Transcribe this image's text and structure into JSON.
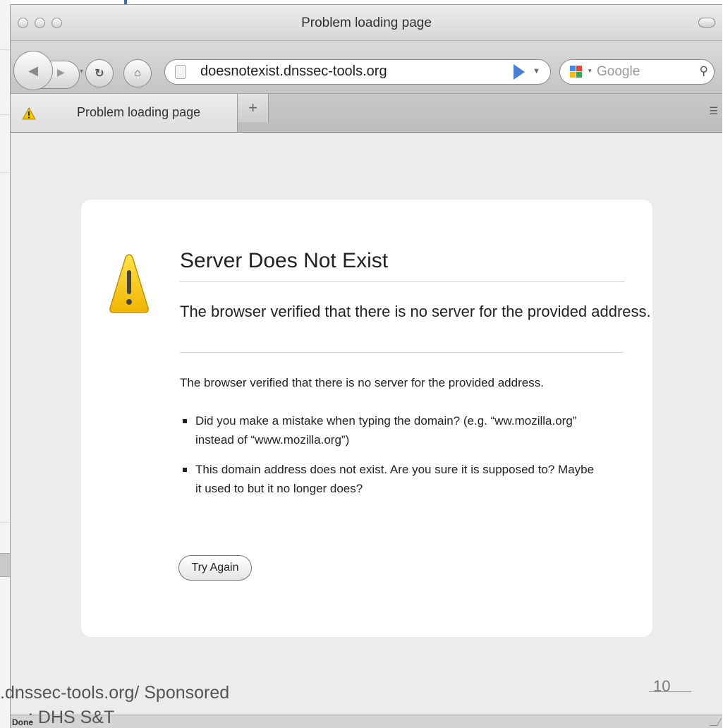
{
  "window": {
    "title": "Problem loading page"
  },
  "toolbar": {
    "url": "doesnotexist.dnssec-tools.org",
    "search_placeholder": "Google",
    "go_color": "#4a7fd6"
  },
  "tabs": [
    {
      "label": "Problem loading page",
      "icon": "warning-icon"
    }
  ],
  "new_tab_label": "+",
  "error": {
    "title": "Server Does Not Exist",
    "short_desc": "The browser verified that there is no server for the provided address.",
    "long_desc": "The browser verified that there is no server for the provided address.",
    "bullets": [
      "Did you make a mistake when typing the domain? (e.g. “ww.mozilla.org” instead of “www.mozilla.org”)",
      "This domain address does not exist. Are you sure it is supposed to? Maybe it used to but it no longer does?"
    ],
    "try_again": "Try Again",
    "warning_color": "#f5c400"
  },
  "status": {
    "text": "Done"
  },
  "slide": {
    "footer_line1": ".dnssec-tools.org/ Sponsored",
    "footer_line2": ": DHS S&T",
    "page_number": "10"
  }
}
